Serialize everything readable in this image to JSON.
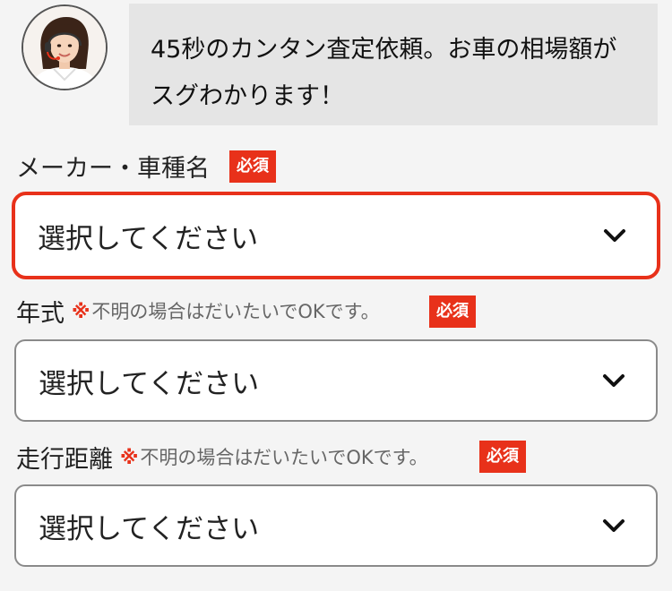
{
  "banner": {
    "avatar_icon": "operator-avatar",
    "message_line1": "45秒のカンタン査定依頼。お車の相場額が",
    "message_line2": "スグわかります！"
  },
  "fields": {
    "maker": {
      "label": "メーカー・車種名",
      "required": "必須",
      "select_value": "選択してください"
    },
    "year": {
      "label": "年式",
      "note_mark": "※",
      "note": "不明の場合はだいたいでOKです。",
      "required": "必須",
      "select_value": "選択してください"
    },
    "mileage": {
      "label": "走行距離",
      "note_mark": "※",
      "note": "不明の場合はだいたいでOKです。",
      "required": "必須",
      "select_value": "選択してください"
    }
  },
  "colors": {
    "accent": "#e8311a",
    "bubble": "#e5e5e5",
    "background": "#f4f4f4",
    "border": "#8a8a8a"
  },
  "icons": {
    "dropdown": "chevron-down-icon"
  }
}
